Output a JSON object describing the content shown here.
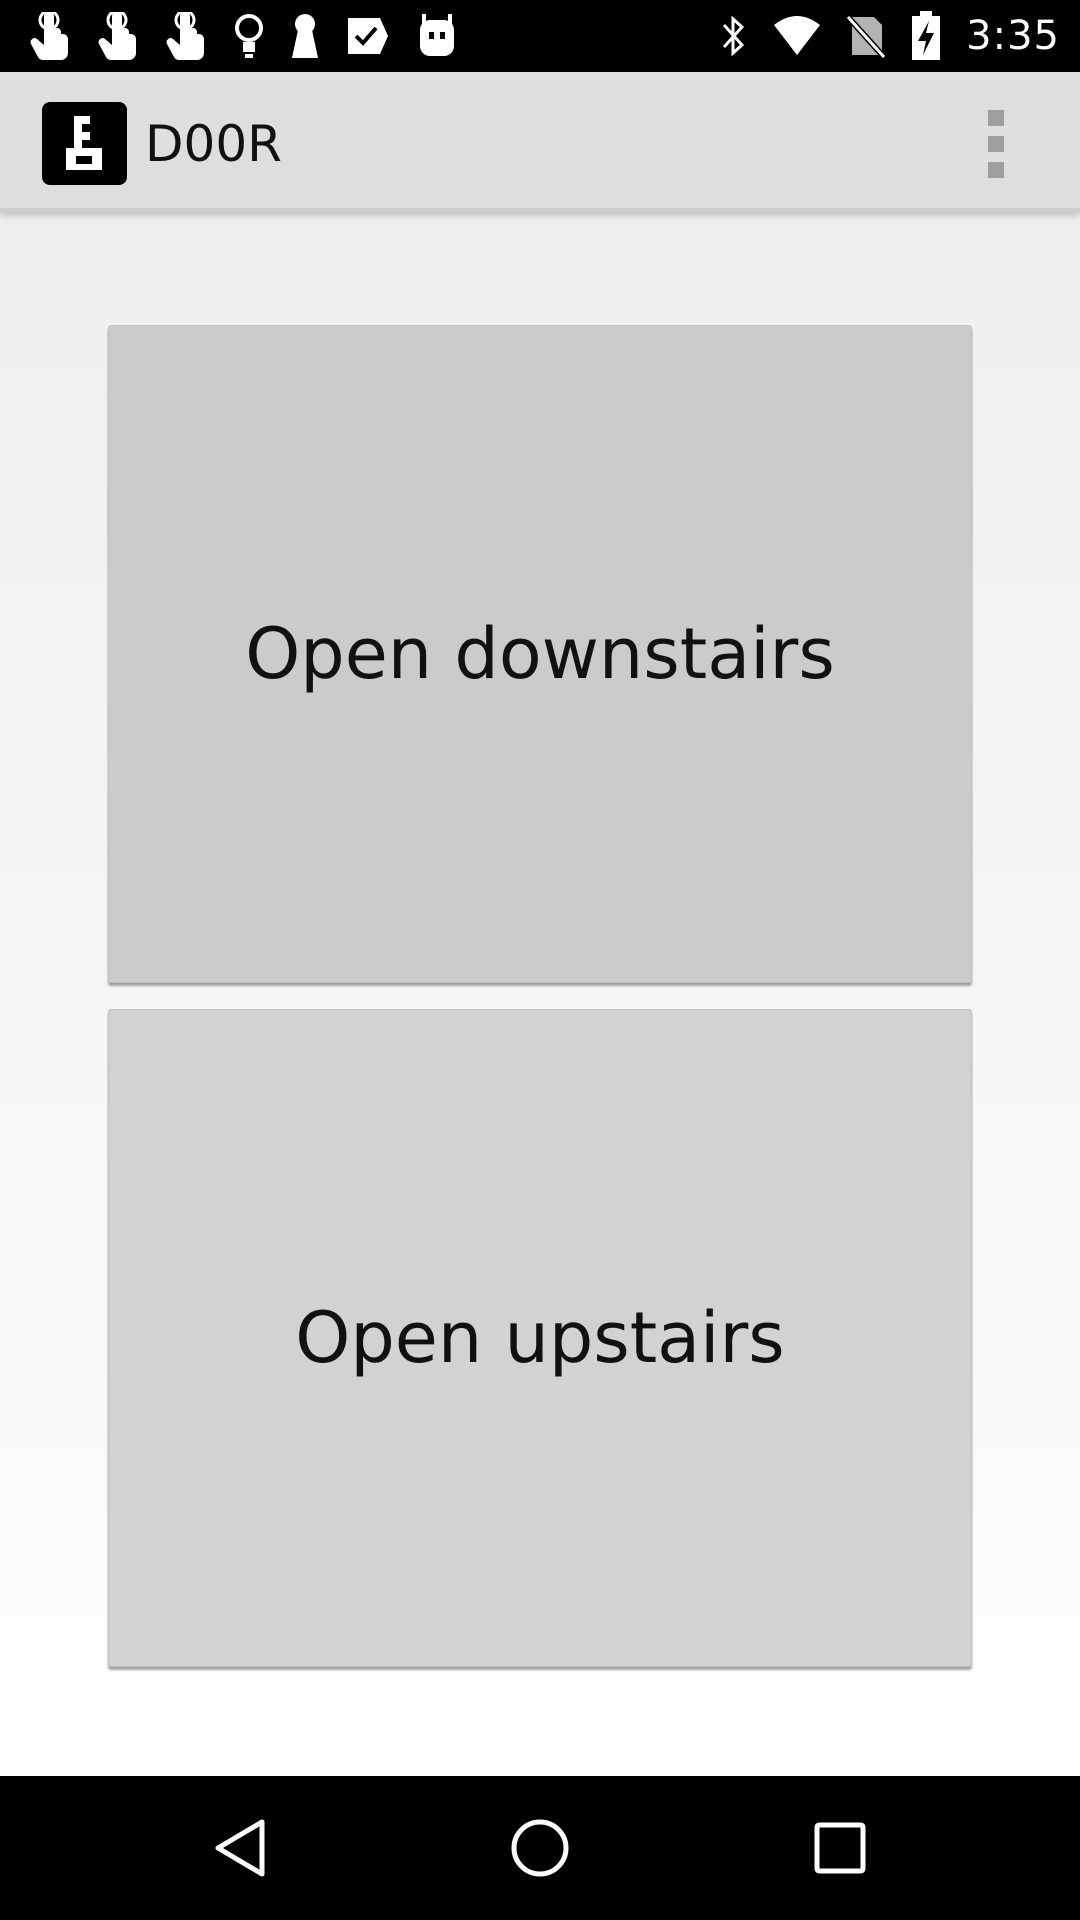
{
  "status_bar": {
    "time": "3:35",
    "left_icons": [
      "tap-icon",
      "tap-icon",
      "tap-icon",
      "lightbulb-icon",
      "keyhole-icon",
      "check-icon",
      "android-icon"
    ],
    "right_icons": [
      "bluetooth-icon",
      "wifi-icon",
      "no-sim-icon",
      "battery-charging-icon"
    ]
  },
  "app_bar": {
    "title": "D00R",
    "logo_icon": "lock-logo-icon",
    "menu_icon": "overflow-menu-icon"
  },
  "buttons": {
    "downstairs": "Open downstairs",
    "upstairs": "Open upstairs"
  },
  "nav_bar": {
    "back_icon": "back-icon",
    "home_icon": "home-icon",
    "recents_icon": "recents-icon"
  },
  "colors": {
    "status_bar": "#000000",
    "app_bar": "#dedede",
    "button": "#cccccc",
    "nav_bar": "#000000"
  }
}
